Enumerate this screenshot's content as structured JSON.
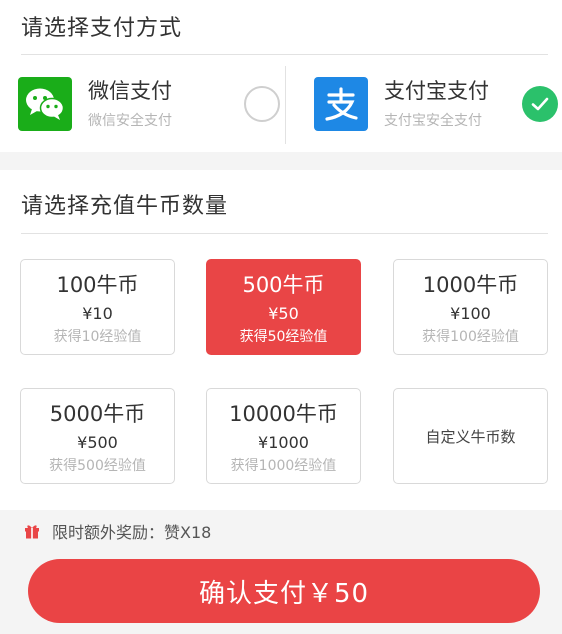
{
  "payment": {
    "title": "请选择支付方式",
    "options": [
      {
        "name": "微信支付",
        "subtitle": "微信安全支付",
        "selected": false
      },
      {
        "name": "支付宝支付",
        "subtitle": "支付宝安全支付",
        "selected": true
      }
    ],
    "colors": {
      "wechat": "#1aad19",
      "alipay": "#1e88e5",
      "check": "#2bc16b"
    }
  },
  "coins": {
    "title": "请选择充值牛币数量",
    "options": [
      {
        "amount": "100牛币",
        "price": "¥10",
        "exp": "获得10经验值",
        "selected": false
      },
      {
        "amount": "500牛币",
        "price": "¥50",
        "exp": "获得50经验值",
        "selected": true
      },
      {
        "amount": "1000牛币",
        "price": "¥100",
        "exp": "获得100经验值",
        "selected": false
      },
      {
        "amount": "5000牛币",
        "price": "¥500",
        "exp": "获得500经验值",
        "selected": false
      },
      {
        "amount": "10000牛币",
        "price": "¥1000",
        "exp": "获得1000经验值",
        "selected": false
      }
    ],
    "custom_label": "自定义牛币数",
    "accent": "#e94546"
  },
  "bonus": {
    "icon": "gift-icon",
    "text": "限时额外奖励：赞X18"
  },
  "confirm": {
    "label": "确认支付￥50"
  }
}
